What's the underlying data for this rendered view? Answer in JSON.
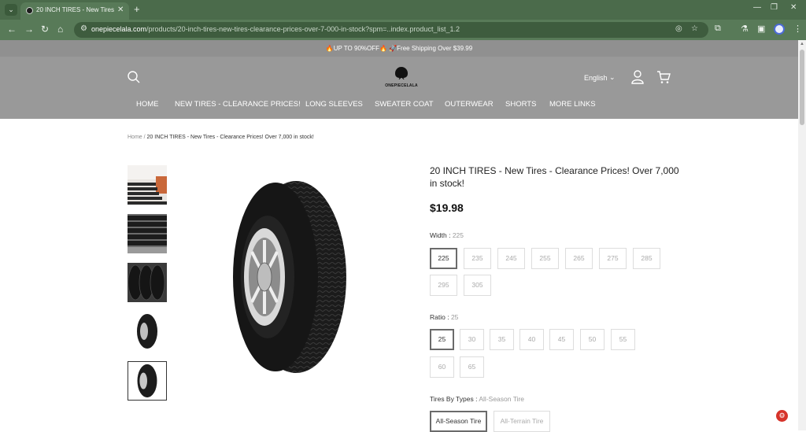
{
  "browser": {
    "tab_title": "20 INCH TIRES - New Tires - Cle",
    "url_host": "onepiecelala.com",
    "url_path": "/products/20-inch-tires-new-tires-clearance-prices-over-7-000-in-stock?spm=..index.product_list_1.2"
  },
  "announcement": "🔥UP TO 90%OFF🔥 🚀Free Shipping Over $39.99",
  "header": {
    "logo_text": "ONEPIECELALA",
    "language": "English",
    "nav": [
      "HOME",
      "NEW TIRES - CLEARANCE PRICES!",
      "LONG SLEEVES",
      "SWEATER COAT",
      "OUTERWEAR",
      "SHORTS",
      "MORE LINKS"
    ]
  },
  "breadcrumb": {
    "home": "Home",
    "separator": " / ",
    "current": "20 INCH TIRES - New Tires - Clearance Prices! Over 7,000 in stock!"
  },
  "product": {
    "title": "20 INCH TIRES - New Tires - Clearance Prices! Over 7,000 in stock!",
    "price": "$19.98"
  },
  "options": {
    "width": {
      "label": "Width",
      "selected": "225",
      "values": [
        "225",
        "235",
        "245",
        "255",
        "265",
        "275",
        "285",
        "295",
        "305"
      ]
    },
    "ratio": {
      "label": "Ratio",
      "selected": "25",
      "values": [
        "25",
        "30",
        "35",
        "40",
        "45",
        "50",
        "55",
        "60",
        "65"
      ]
    },
    "types": {
      "label": "Tires By Types",
      "selected": "All-Season Tire",
      "values": [
        "All-Season Tire",
        "All-Terrain Tire"
      ]
    }
  },
  "colors": {
    "tab_bar": "#4b6b4b",
    "toolbar": "#587a58",
    "header_bg": "#999999",
    "announce_bg": "#909090"
  }
}
